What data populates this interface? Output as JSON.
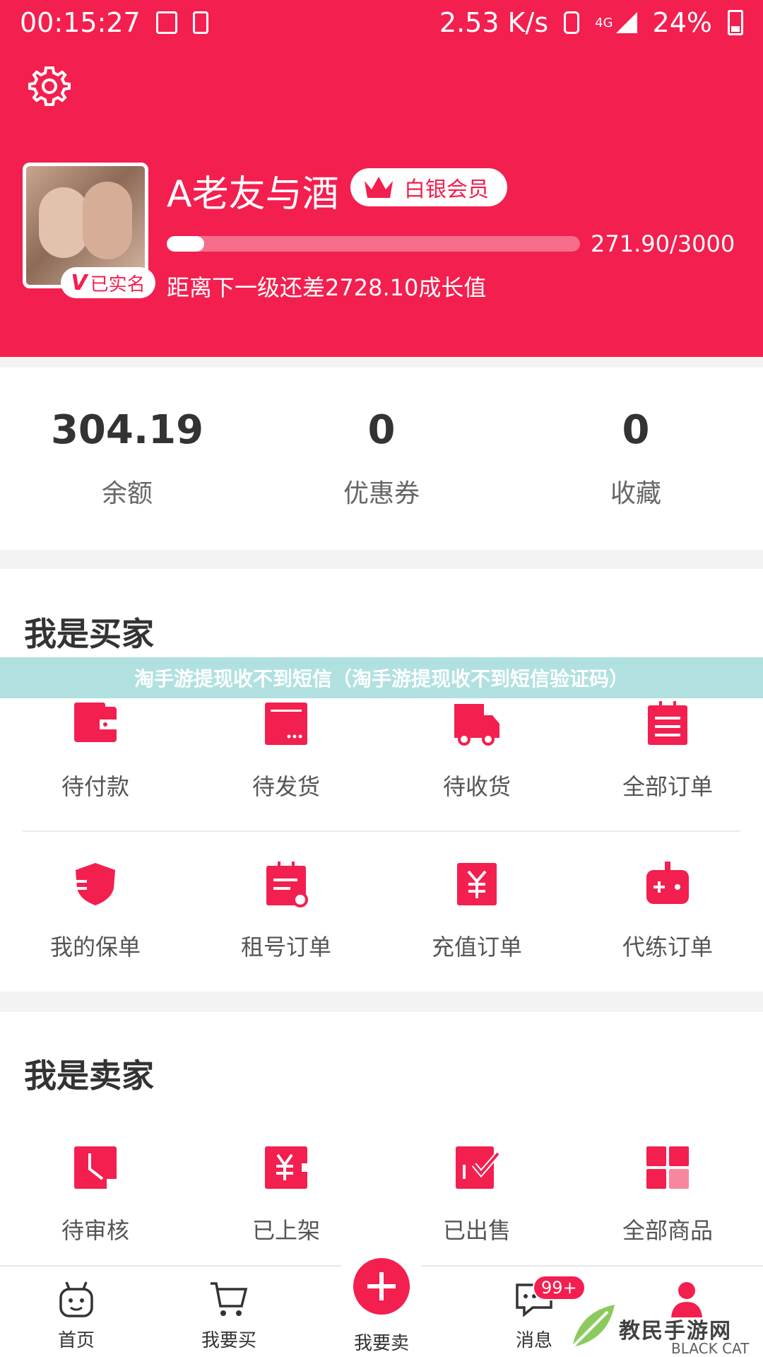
{
  "status_bar": {
    "time": "00:15:27",
    "speed": "2.53 K/s",
    "network": "4G",
    "battery": "24%"
  },
  "profile": {
    "username": "A老友与酒",
    "vip_label": "白银会员",
    "verified_label": "已实名",
    "verified_mark": "V",
    "progress_fraction": 0.0906,
    "progress_text": "271.90/3000",
    "next_level_text": "距离下一级还差2728.10成长值"
  },
  "stats": [
    {
      "value": "304.19",
      "label": "余额"
    },
    {
      "value": "0",
      "label": "优惠券"
    },
    {
      "value": "0",
      "label": "收藏"
    }
  ],
  "banner": "淘手游提现收不到短信（淘手游提现收不到短信验证码）",
  "buyer": {
    "title": "我是买家",
    "row1": [
      {
        "label": "待付款",
        "icon": "wallet-icon"
      },
      {
        "label": "待发货",
        "icon": "package-icon"
      },
      {
        "label": "待收货",
        "icon": "truck-icon"
      },
      {
        "label": "全部订单",
        "icon": "order-list-icon"
      }
    ],
    "row2": [
      {
        "label": "我的保单",
        "icon": "shield-icon"
      },
      {
        "label": "租号订单",
        "icon": "rent-order-icon"
      },
      {
        "label": "充值订单",
        "icon": "recharge-icon"
      },
      {
        "label": "代练订单",
        "icon": "gamepad-icon"
      }
    ]
  },
  "seller": {
    "title": "我是卖家",
    "row1": [
      {
        "label": "待审核",
        "icon": "clock-icon"
      },
      {
        "label": "已上架",
        "icon": "yen-tag-icon"
      },
      {
        "label": "已出售",
        "icon": "sold-check-icon"
      },
      {
        "label": "全部商品",
        "icon": "grid-icon"
      }
    ]
  },
  "bottom_nav": {
    "home": "首页",
    "buy": "我要买",
    "sell": "我要卖",
    "messages": "消息",
    "messages_badge": "99+"
  },
  "watermark": {
    "text": "教民手游网",
    "sub": "BLACK CAT"
  },
  "colors": {
    "accent": "#f31f4f",
    "banner": "#a2dcda"
  }
}
